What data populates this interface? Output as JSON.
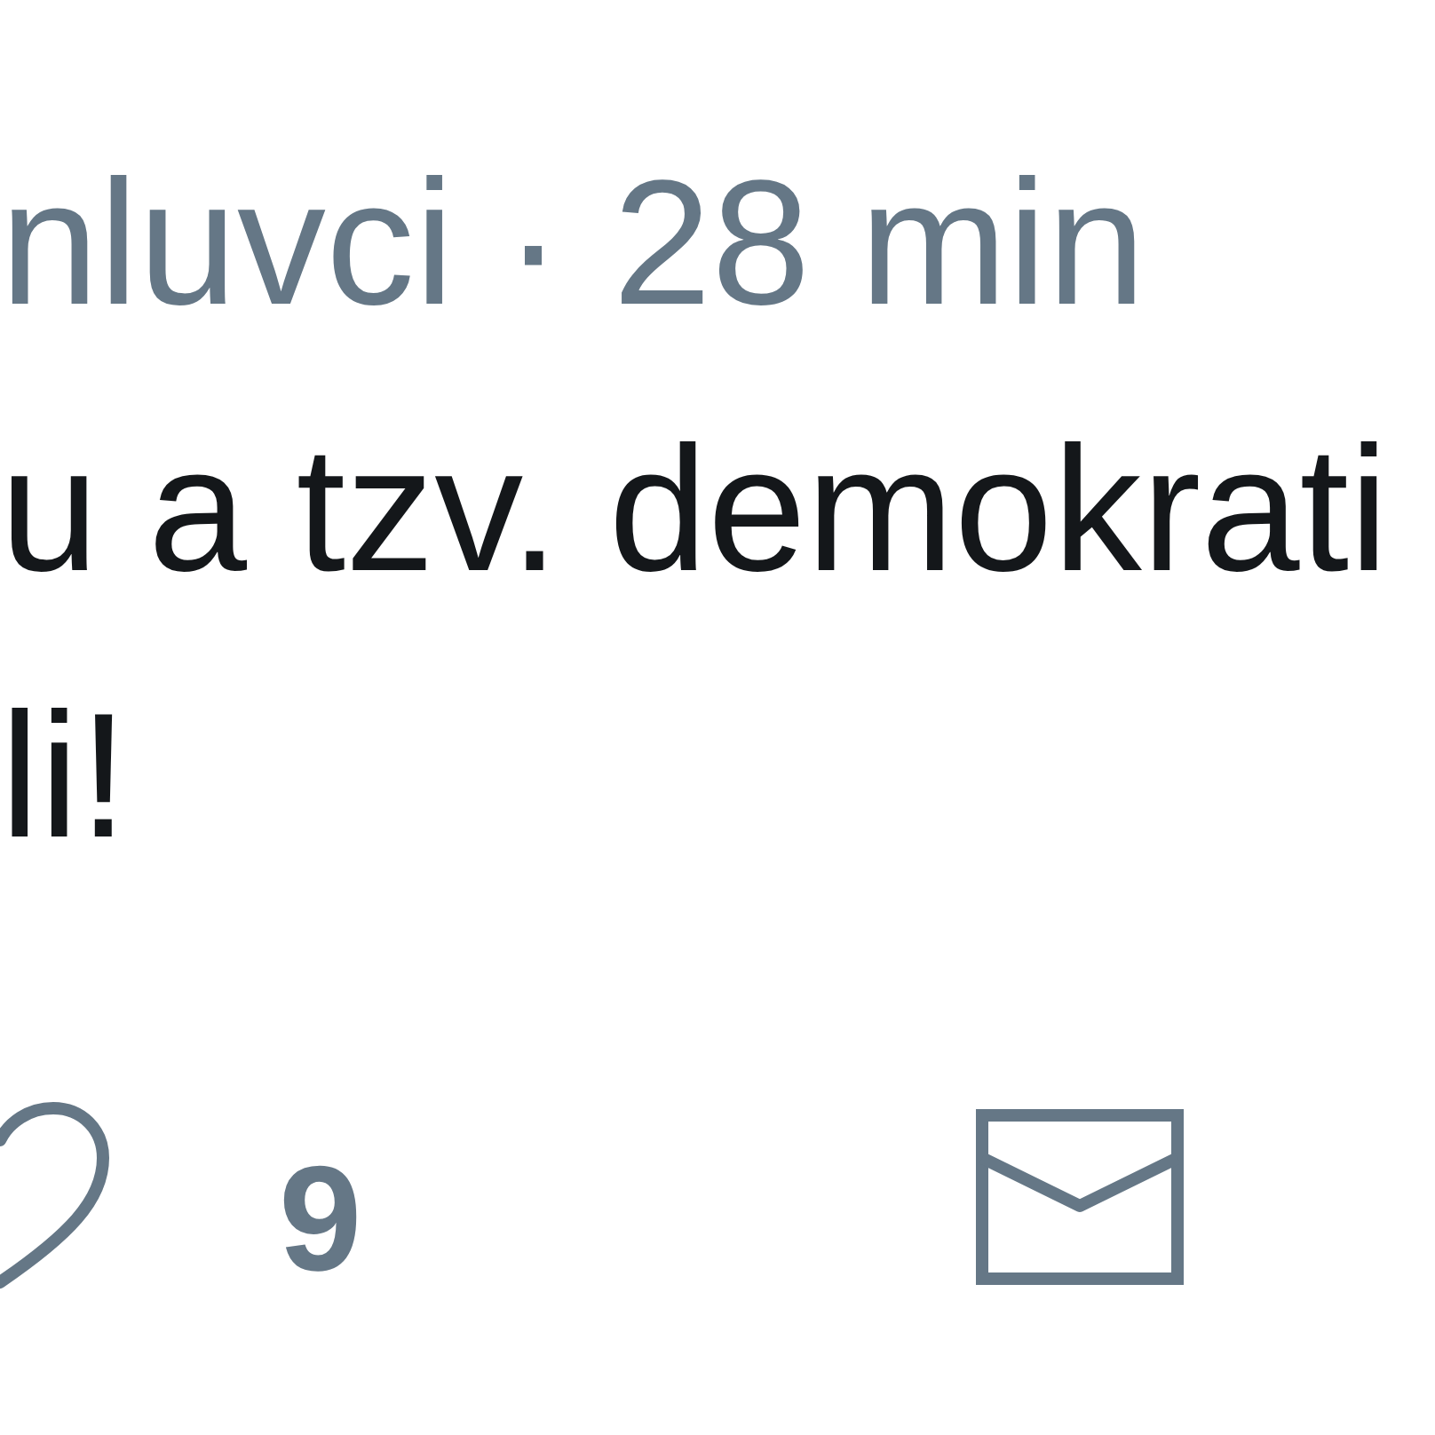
{
  "header": {
    "name_fragment": "nluvci",
    "separator": "·",
    "time": "28 min"
  },
  "text_lines": [
    "u a tzv. demokrati",
    "li!"
  ],
  "actions": [
    {
      "kind": "like",
      "count": "9"
    },
    {
      "kind": "message"
    }
  ]
}
